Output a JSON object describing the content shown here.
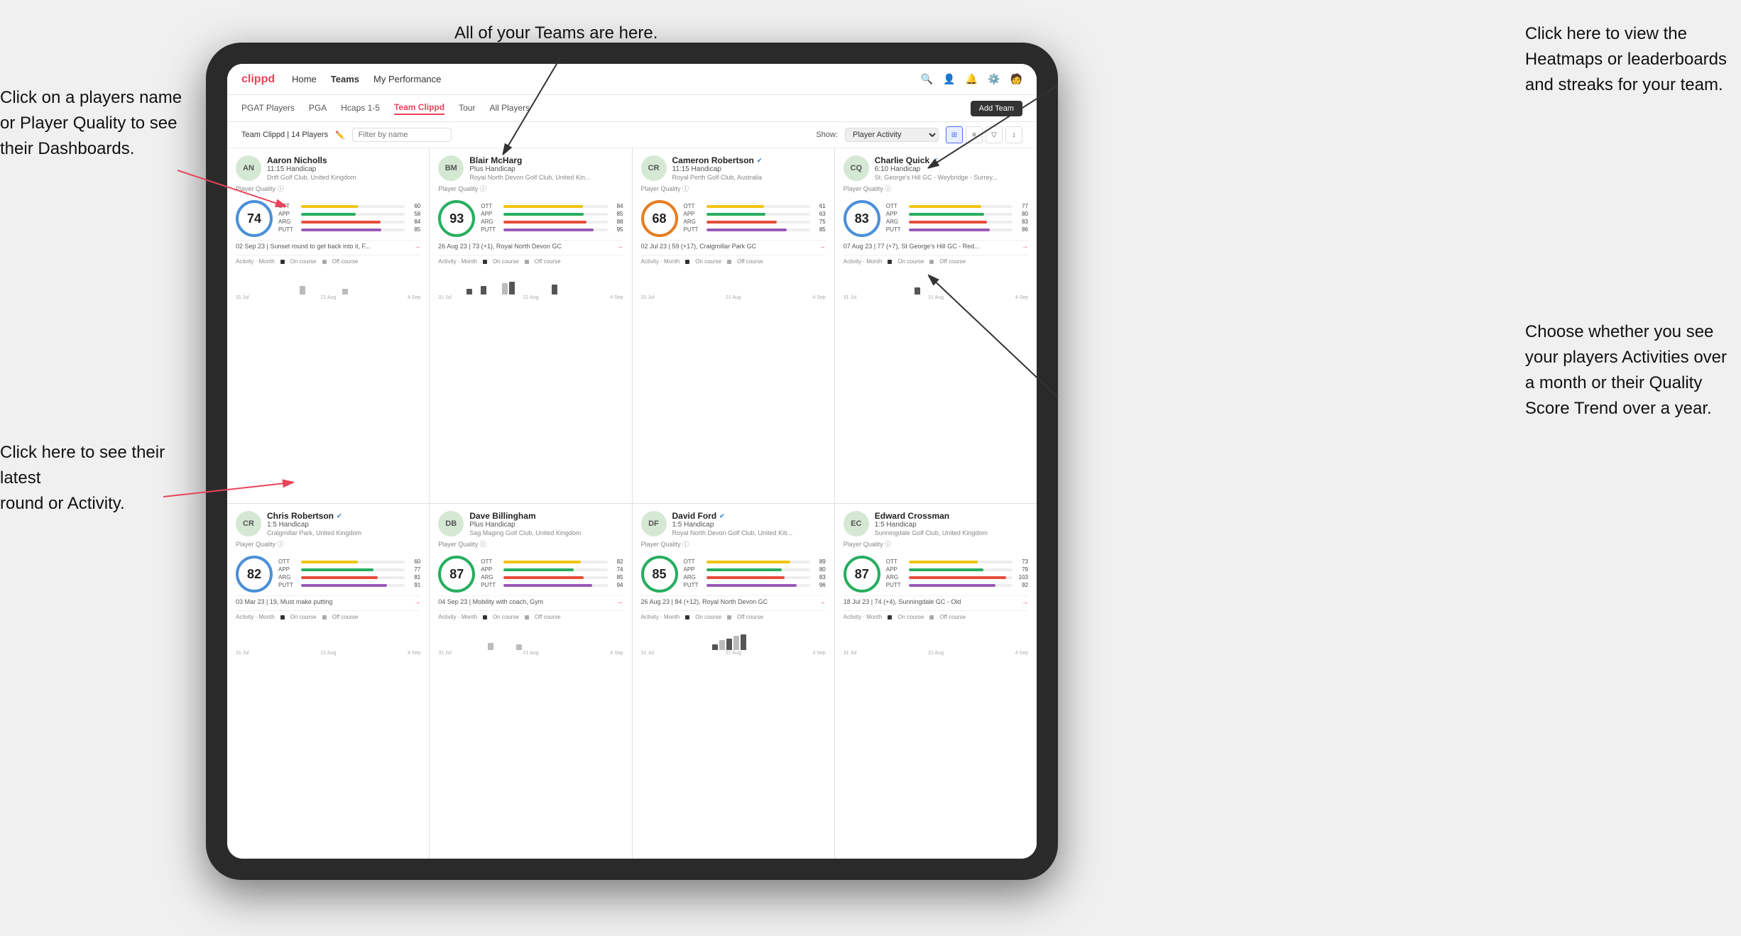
{
  "annotations": {
    "top_left": "Click on a players name\nor Player Quality to see\ntheir Dashboards.",
    "bottom_left": "Click here to see their latest\nround or Activity.",
    "top_right_title": "All of your Teams are here.",
    "right_top": "Click here to view the\nHeatmaps or leaderboards\nand streaks for your team.",
    "right_bottom": "Choose whether you see\nyour players Activities over\na month or their Quality\nScore Trend over a year."
  },
  "nav": {
    "logo": "clippd",
    "items": [
      "Home",
      "Teams",
      "My Performance"
    ],
    "active": "Teams"
  },
  "sub_tabs": {
    "items": [
      "PGAT Players",
      "PGA",
      "Hcaps 1-5",
      "Team Clippd",
      "Tour",
      "All Players"
    ],
    "active": "Team Clippd"
  },
  "toolbar": {
    "team_label": "Team Clippd | 14 Players",
    "filter_placeholder": "Filter by name",
    "show_label": "Show:",
    "show_value": "Player Activity",
    "add_team": "Add Team"
  },
  "players": [
    {
      "name": "Aaron Nicholls",
      "handicap": "11:15 Handicap",
      "club": "Drift Golf Club, United Kingdom",
      "quality": 74,
      "quality_color": "blue",
      "stats": [
        {
          "label": "OTT",
          "value": 60,
          "color": "bar-yellow"
        },
        {
          "label": "APP",
          "value": 58,
          "color": "bar-green"
        },
        {
          "label": "ARG",
          "value": 84,
          "color": "bar-red"
        },
        {
          "label": "PUTT",
          "value": 85,
          "color": "bar-purple"
        }
      ],
      "recent": "02 Sep 23 | Sunset round to get back into it, F...",
      "chart_bars": [
        0,
        0,
        0,
        0,
        0,
        0,
        0,
        0,
        0,
        12,
        0,
        0,
        0,
        0,
        0,
        8,
        0,
        0,
        0,
        0
      ],
      "chart_labels": [
        "31 Jul",
        "21 Aug",
        "4 Sep"
      ]
    },
    {
      "name": "Blair McHarg",
      "handicap": "Plus Handicap",
      "club": "Royal North Devon Golf Club, United Kin...",
      "quality": 93,
      "quality_color": "green",
      "stats": [
        {
          "label": "OTT",
          "value": 84,
          "color": "bar-yellow"
        },
        {
          "label": "APP",
          "value": 85,
          "color": "bar-green"
        },
        {
          "label": "ARG",
          "value": 88,
          "color": "bar-red"
        },
        {
          "label": "PUTT",
          "value": 95,
          "color": "bar-purple"
        }
      ],
      "recent": "26 Aug 23 | 73 (+1), Royal North Devon GC",
      "chart_bars": [
        0,
        0,
        0,
        0,
        8,
        0,
        12,
        0,
        0,
        16,
        18,
        0,
        0,
        0,
        0,
        0,
        14,
        0,
        0,
        0
      ],
      "chart_labels": [
        "31 Jul",
        "21 Aug",
        "4 Sep"
      ]
    },
    {
      "name": "Cameron Robertson",
      "handicap": "11:15 Handicap",
      "club": "Royal Perth Golf Club, Australia",
      "quality": 68,
      "quality_color": "orange",
      "verified": true,
      "stats": [
        {
          "label": "OTT",
          "value": 61,
          "color": "bar-yellow"
        },
        {
          "label": "APP",
          "value": 63,
          "color": "bar-green"
        },
        {
          "label": "ARG",
          "value": 75,
          "color": "bar-red"
        },
        {
          "label": "PUTT",
          "value": 85,
          "color": "bar-purple"
        }
      ],
      "recent": "02 Jul 23 | 59 (+17), Craigmillar Park GC",
      "chart_bars": [
        0,
        0,
        0,
        0,
        0,
        0,
        0,
        0,
        0,
        0,
        0,
        0,
        0,
        0,
        0,
        0,
        0,
        0,
        0,
        0
      ],
      "chart_labels": [
        "31 Jul",
        "21 Aug",
        "4 Sep"
      ]
    },
    {
      "name": "Charlie Quick",
      "handicap": "6:10 Handicap",
      "club": "St. George's Hill GC - Weybridge - Surrey...",
      "quality": 83,
      "quality_color": "blue",
      "verified": true,
      "stats": [
        {
          "label": "OTT",
          "value": 77,
          "color": "bar-yellow"
        },
        {
          "label": "APP",
          "value": 80,
          "color": "bar-green"
        },
        {
          "label": "ARG",
          "value": 83,
          "color": "bar-red"
        },
        {
          "label": "PUTT",
          "value": 86,
          "color": "bar-purple"
        }
      ],
      "recent": "07 Aug 23 | 77 (+7), St George's Hill GC - Red...",
      "chart_bars": [
        0,
        0,
        0,
        0,
        0,
        0,
        0,
        0,
        0,
        0,
        10,
        0,
        0,
        0,
        0,
        0,
        0,
        0,
        0,
        0
      ],
      "chart_labels": [
        "31 Jul",
        "21 Aug",
        "4 Sep"
      ]
    },
    {
      "name": "Chris Robertson",
      "handicap": "1:5 Handicap",
      "club": "Craigmillar Park, United Kingdom",
      "quality": 82,
      "quality_color": "blue",
      "verified": true,
      "stats": [
        {
          "label": "OTT",
          "value": 60,
          "color": "bar-yellow"
        },
        {
          "label": "APP",
          "value": 77,
          "color": "bar-green"
        },
        {
          "label": "ARG",
          "value": 81,
          "color": "bar-red"
        },
        {
          "label": "PUTT",
          "value": 91,
          "color": "bar-purple"
        }
      ],
      "recent": "03 Mar 23 | 19, Must make putting",
      "chart_bars": [
        0,
        0,
        0,
        0,
        0,
        0,
        0,
        0,
        0,
        0,
        0,
        0,
        0,
        0,
        0,
        0,
        0,
        0,
        0,
        0
      ],
      "chart_labels": [
        "31 Jul",
        "21 Aug",
        "4 Sep"
      ]
    },
    {
      "name": "Dave Billingham",
      "handicap": "Plus Handicap",
      "club": "Sag Maging Golf Club, United Kingdom",
      "quality": 87,
      "quality_color": "green",
      "stats": [
        {
          "label": "OTT",
          "value": 82,
          "color": "bar-yellow"
        },
        {
          "label": "APP",
          "value": 74,
          "color": "bar-green"
        },
        {
          "label": "ARG",
          "value": 85,
          "color": "bar-red"
        },
        {
          "label": "PUTT",
          "value": 94,
          "color": "bar-purple"
        }
      ],
      "recent": "04 Sep 23 | Mobility with coach, Gym",
      "chart_bars": [
        0,
        0,
        0,
        0,
        0,
        0,
        0,
        10,
        0,
        0,
        0,
        8,
        0,
        0,
        0,
        0,
        0,
        0,
        0,
        0
      ],
      "chart_labels": [
        "31 Jul",
        "21 Aug",
        "4 Sep"
      ]
    },
    {
      "name": "David Ford",
      "handicap": "1:5 Handicap",
      "club": "Royal North Devon Golf Club, United Kiti...",
      "quality": 85,
      "quality_color": "green",
      "verified": true,
      "stats": [
        {
          "label": "OTT",
          "value": 89,
          "color": "bar-yellow"
        },
        {
          "label": "APP",
          "value": 80,
          "color": "bar-green"
        },
        {
          "label": "ARG",
          "value": 83,
          "color": "bar-red"
        },
        {
          "label": "PUTT",
          "value": 96,
          "color": "bar-purple"
        }
      ],
      "recent": "26 Aug 23 | 84 (+12), Royal North Devon GC",
      "chart_bars": [
        0,
        0,
        0,
        0,
        0,
        0,
        0,
        0,
        0,
        0,
        8,
        14,
        16,
        20,
        22,
        0,
        0,
        0,
        0,
        0
      ],
      "chart_labels": [
        "31 Jul",
        "21 Aug",
        "4 Sep"
      ]
    },
    {
      "name": "Edward Crossman",
      "handicap": "1:5 Handicap",
      "club": "Sunningdale Golf Club, United Kingdom",
      "quality": 87,
      "quality_color": "green",
      "stats": [
        {
          "label": "OTT",
          "value": 73,
          "color": "bar-yellow"
        },
        {
          "label": "APP",
          "value": 79,
          "color": "bar-green"
        },
        {
          "label": "ARG",
          "value": 103,
          "color": "bar-red"
        },
        {
          "label": "PUTT",
          "value": 92,
          "color": "bar-purple"
        }
      ],
      "recent": "18 Jul 23 | 74 (+4), Sunningdale GC - Old",
      "chart_bars": [
        0,
        0,
        0,
        0,
        0,
        0,
        0,
        0,
        0,
        0,
        0,
        0,
        0,
        0,
        0,
        0,
        0,
        0,
        0,
        0
      ],
      "chart_labels": [
        "31 Jul",
        "21 Aug",
        "4 Sep"
      ]
    }
  ]
}
